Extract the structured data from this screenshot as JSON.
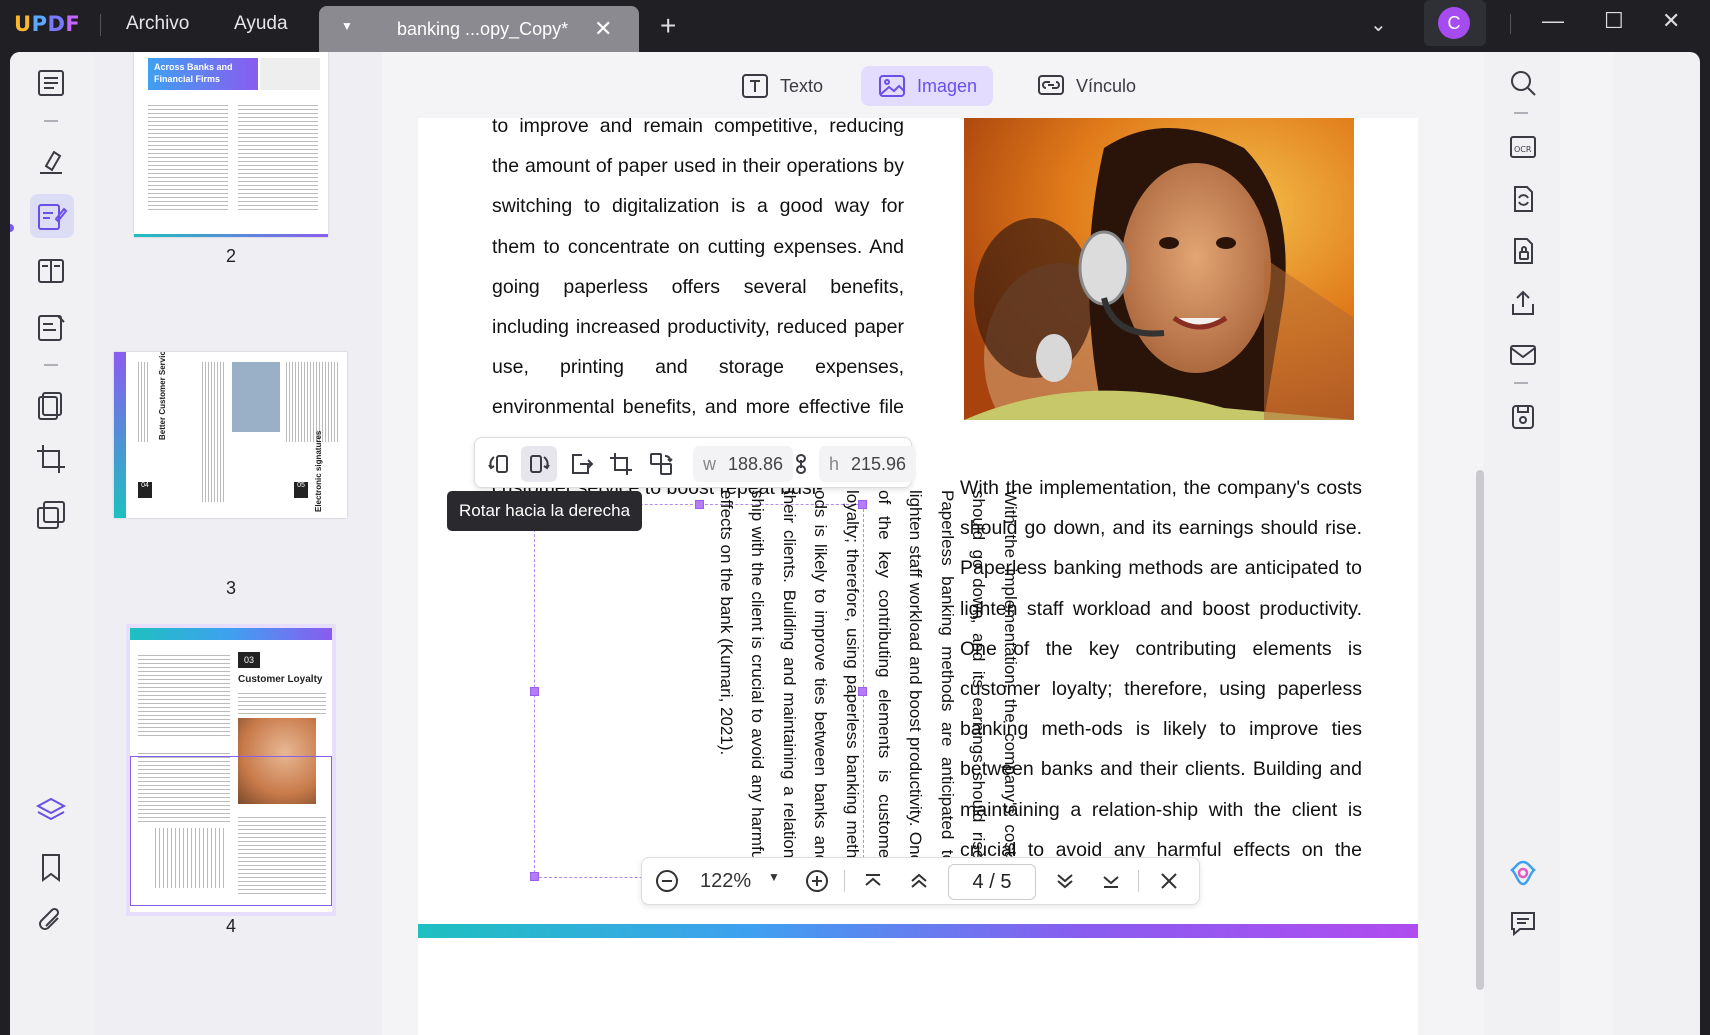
{
  "app": {
    "logo": "UPDF",
    "menus": [
      "Archivo",
      "Ayuda"
    ],
    "tab_title": "banking ...opy_Copy*",
    "avatar_letter": "C"
  },
  "toolbar": {
    "text_label": "Texto",
    "image_label": "Imagen",
    "link_label": "Vínculo"
  },
  "thumbnails": {
    "pages": [
      "2",
      "3",
      "4"
    ],
    "page2_heading": "Across Banks and Financial Firms",
    "page3_heading_a": "Better Customer Services and Communication",
    "page3_num_a": "04",
    "page3_heading_b": "Electronic signatures",
    "page3_num_b": "05",
    "page4_num": "03",
    "page4_heading": "Customer Loyalty"
  },
  "document": {
    "left_paragraph": "to improve and remain competitive, reducing the amount of paper used in their operations by switching to digitalization is a good way for them to concentrate on cutting expenses. And going paperless offers several benefits, including increased productivity, reduced paper use, printing and storage expenses, environmental benefits, and more effective file and information retrieval while improving customer service to boost repeat busi-",
    "right_paragraph": "With the implementation, the company's costs should go down, and its earnings should rise. Paperless banking methods are anticipated to lighten staff workload and boost productivity. One of the key contributing elements is customer loyalty; therefore, using paperless banking meth-ods is likely to improve ties between banks and their clients. Building and maintaining a relation-ship with the client is crucial to avoid any harmful effects on the bank (Kumari, 2021).",
    "rotated_paragraph": "With the implementation, the company's costs should go down, and its earnings should rise. Paperless banking methods are anticipated to lighten staff workload and boost productivity. One of the key contributing elements is customer loyalty; therefore, using paperless banking meth-ods is likely to improve ties between banks and their clients. Building and maintaining a relation-ship with the client is crucial to avoid any harmful effects on the bank (Kumari, 2021)."
  },
  "image_toolbar": {
    "w_label": "w",
    "w_value": "188.86",
    "h_label": "h",
    "h_value": "215.96",
    "tooltip": "Rotar hacia la derecha"
  },
  "zoom": {
    "level": "122%",
    "current_page": "4",
    "separator": "/",
    "total_pages": "5"
  },
  "colors": {
    "accent": "#7c5cf0",
    "active_bg": "#e3dcff"
  }
}
